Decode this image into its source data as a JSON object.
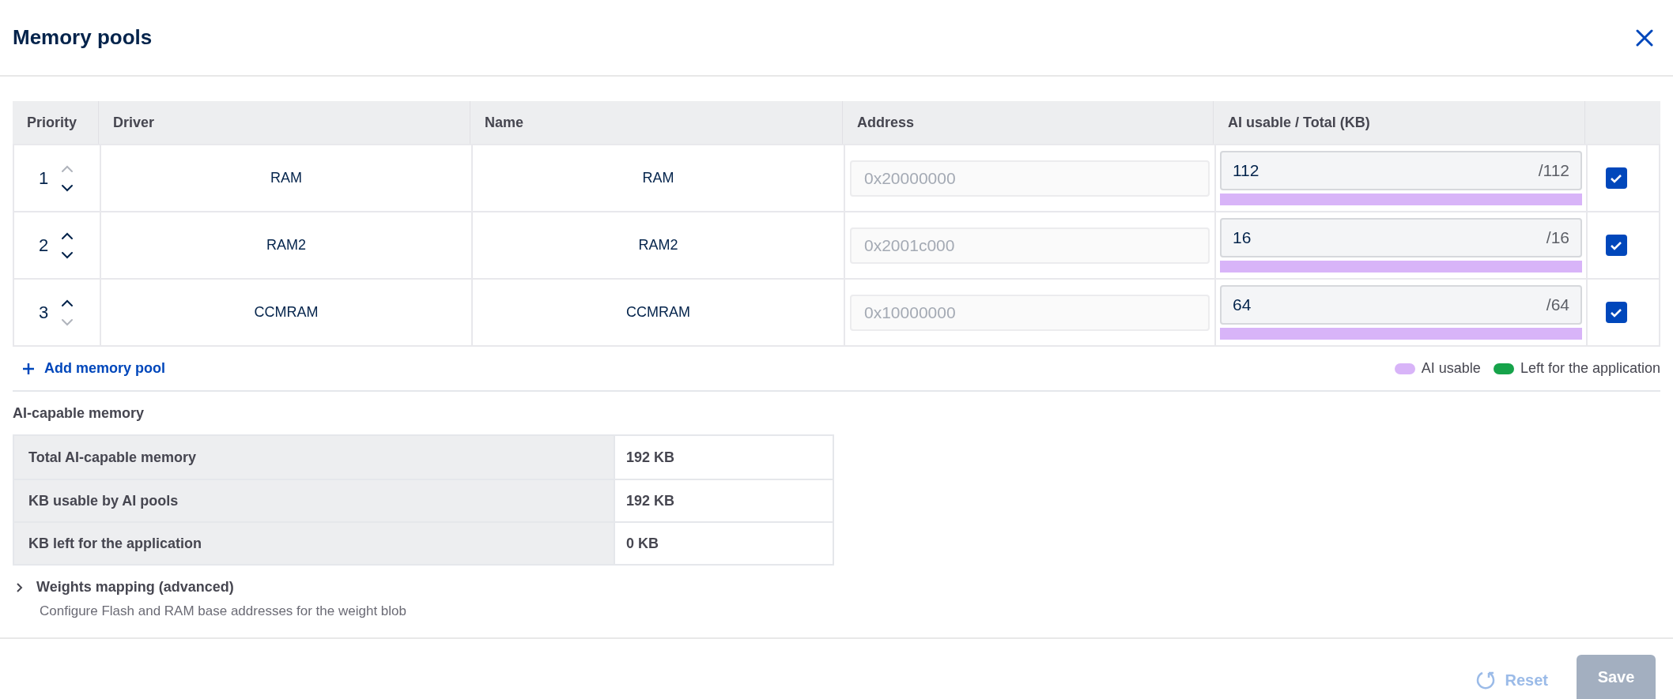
{
  "dialog": {
    "title": "Memory pools"
  },
  "table": {
    "columns": [
      "Priority",
      "Driver",
      "Name",
      "Address",
      "AI usable / Total (KB)"
    ],
    "rows": [
      {
        "priority": "1",
        "up_disabled": true,
        "down_disabled": false,
        "driver": "RAM",
        "name": "RAM",
        "address": "0x20000000",
        "address_disabled": true,
        "usable": "112",
        "total": "/112",
        "level": 1,
        "checked": true
      },
      {
        "priority": "2",
        "up_disabled": false,
        "down_disabled": false,
        "driver": "RAM2",
        "name": "RAM2",
        "address": "0x2001c000",
        "address_disabled": true,
        "usable": "16",
        "total": "/16",
        "level": 1,
        "checked": true
      },
      {
        "priority": "3",
        "up_disabled": false,
        "down_disabled": true,
        "driver": "CCMRAM",
        "name": "CCMRAM",
        "address": "0x10000000",
        "address_disabled": true,
        "usable": "64",
        "total": "/64",
        "level": 1,
        "checked": true
      }
    ]
  },
  "add_button": "Add memory pool",
  "legend": [
    {
      "label": "AI usable",
      "color": "#d8b4f8"
    },
    {
      "label": "Left for the application",
      "color": "#16a34a"
    }
  ],
  "summary": {
    "title": "AI-capable memory",
    "rows": [
      {
        "label": "Total AI-capable memory",
        "value": "192 KB"
      },
      {
        "label": "KB usable by AI pools",
        "value": "192 KB"
      },
      {
        "label": "KB left for the application",
        "value": "0 KB"
      }
    ]
  },
  "weights_mapping": {
    "title": "Weights mapping (advanced)",
    "description": "Configure Flash and RAM base addresses for the weight blob",
    "expanded": false
  },
  "footer": {
    "reset": {
      "label": "Reset",
      "disabled": true
    },
    "save": {
      "label": "Save",
      "disabled": true
    }
  }
}
